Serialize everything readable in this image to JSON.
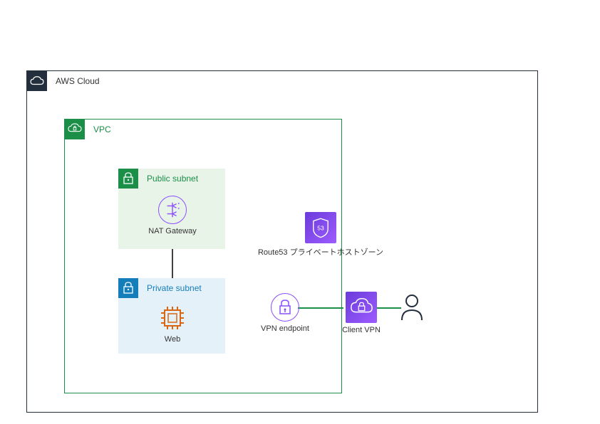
{
  "cloud": {
    "label": "AWS Cloud"
  },
  "vpc": {
    "label": "VPC"
  },
  "public_subnet": {
    "label": "Public subnet"
  },
  "private_subnet": {
    "label": "Private subnet"
  },
  "nat_gateway": {
    "label": "NAT Gateway"
  },
  "web": {
    "label": "Web"
  },
  "route53": {
    "label": "Route53 プライベートホストゾーン"
  },
  "vpn_endpoint": {
    "label": "VPN endpoint"
  },
  "client_vpn": {
    "label": "Client VPN"
  },
  "colors": {
    "aws_border": "#242F3E",
    "vpc_green": "#1B8F48",
    "public_fill": "#E8F4E8",
    "private_blue": "#147EBA",
    "private_fill": "#E5F1F8",
    "purple": "#8C4FFF",
    "orange": "#D86613"
  }
}
